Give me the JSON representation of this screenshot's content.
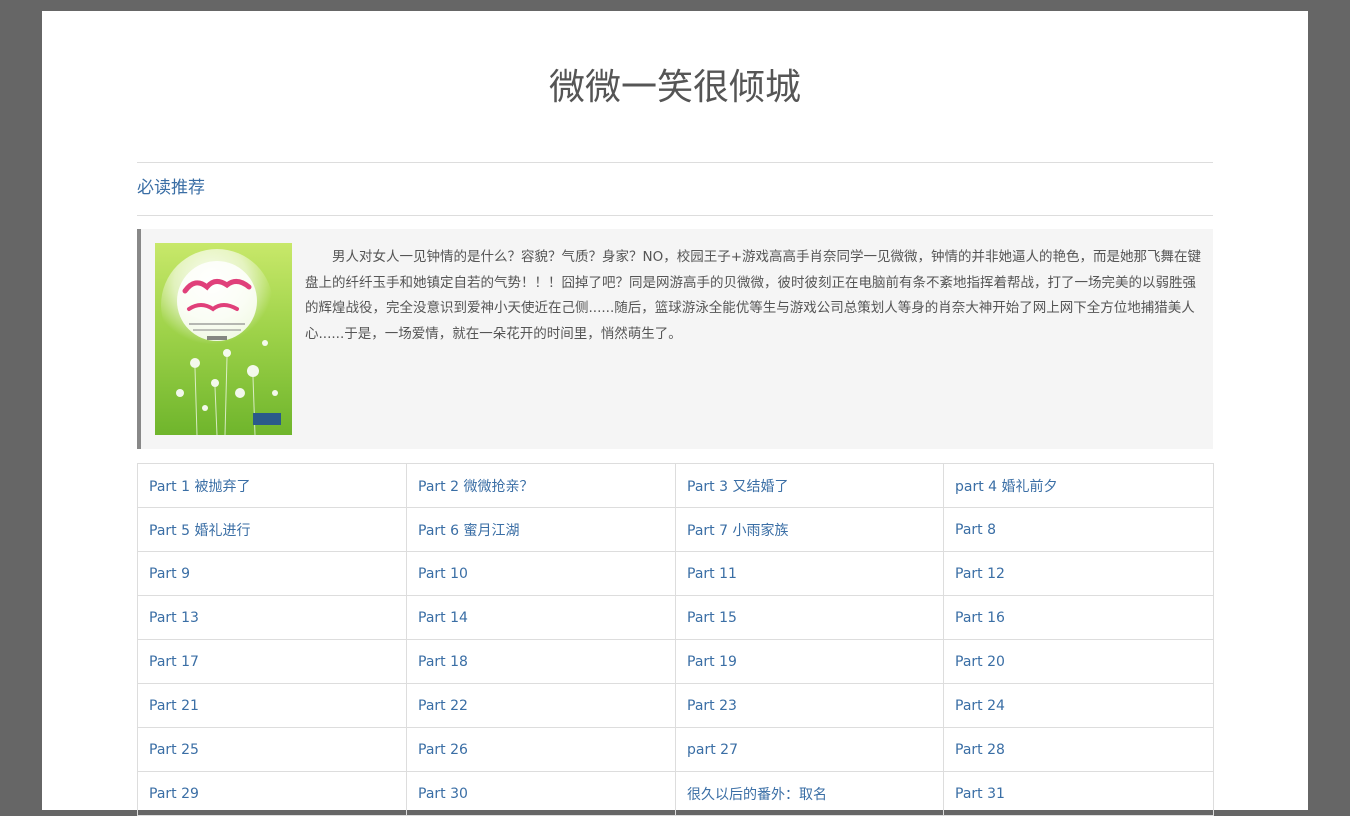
{
  "book": {
    "title": "微微一笑很倾城"
  },
  "section": {
    "label": "必读推荐"
  },
  "intro": {
    "text": "男人对女人一见钟情的是什么？容貌？气质？身家？NO，校园王子+游戏高高手肖奈同学一见微微，钟情的并非她逼人的艳色，而是她那飞舞在键盘上的纤纤玉手和她镇定自若的气势！！！囧掉了吧？同是网游高手的贝微微，彼时彼刻正在电脑前有条不紊地指挥着帮战，打了一场完美的以弱胜强的辉煌战役，完全没意识到爱神小天使近在己侧......随后，篮球游泳全能优等生与游戏公司总策划人等身的肖奈大神开始了网上网下全方位地捕猎美人心......于是，一场爱情，就在一朵花开的时间里，悄然萌生了。"
  },
  "chapters": [
    [
      "Part 1 被抛弃了",
      "Part 2 微微抢亲？",
      "Part 3 又结婚了",
      "part 4 婚礼前夕"
    ],
    [
      "Part 5 婚礼进行",
      "Part 6 蜜月江湖",
      "Part 7 小雨家族",
      "Part 8"
    ],
    [
      "Part 9",
      "Part 10",
      "Part 11",
      "Part 12"
    ],
    [
      "Part 13",
      "Part 14",
      "Part 15",
      "Part 16"
    ],
    [
      "Part 17",
      "Part 18",
      "Part 19",
      "Part 20"
    ],
    [
      "Part 21",
      "Part 22",
      "Part 23",
      "Part 24"
    ],
    [
      "Part 25",
      "Part 26",
      "part 27",
      "Part 28"
    ],
    [
      "Part 29",
      "Part 30",
      "很久以后的番外：取名",
      "Part 31"
    ]
  ]
}
